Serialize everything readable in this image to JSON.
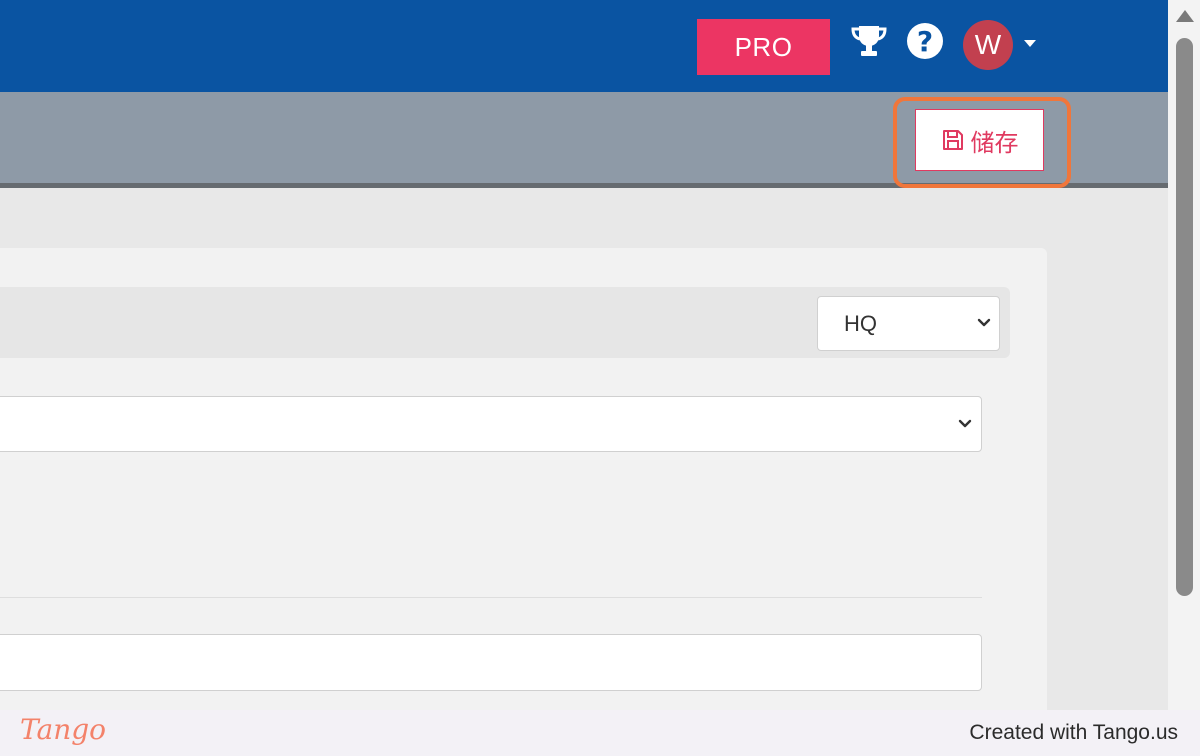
{
  "header": {
    "pro_label": "PRO",
    "avatar_initial": "W",
    "help_glyph": "?",
    "icons": {
      "trophy": "trophy-icon",
      "help": "help-icon",
      "account_menu": "chevron-down-icon"
    }
  },
  "toolbar": {
    "save_label": "储存",
    "save_icon": "floppy-disk-icon"
  },
  "form": {
    "location_select": {
      "selected": "HQ"
    },
    "wide_select": {
      "selected": ""
    },
    "text_input": {
      "value": ""
    }
  },
  "footer": {
    "logo_text": "Tango",
    "credit": "Created with Tango.us"
  },
  "colors": {
    "header_bg": "#0a54a2",
    "pro_bg": "#ec3563",
    "toolbar_bg": "#8e9aa7",
    "save_accent": "#e03a60",
    "highlight": "#f0763b",
    "avatar_bg": "#c2404f"
  }
}
